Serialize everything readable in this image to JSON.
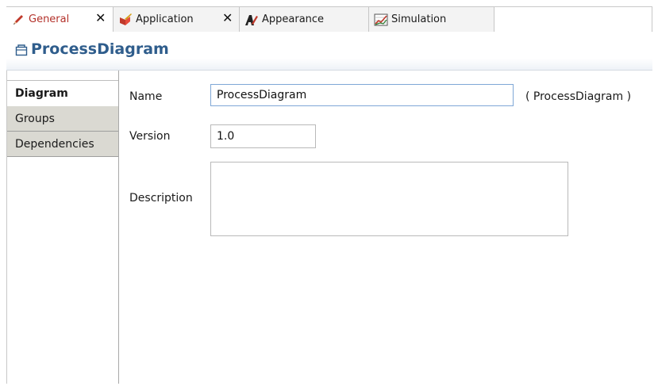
{
  "tabs": [
    {
      "label": "General",
      "icon": "pencil-icon",
      "closable": true,
      "active": true
    },
    {
      "label": "Application",
      "icon": "application-icon",
      "closable": true,
      "active": false
    },
    {
      "label": "Appearance",
      "icon": "appearance-icon",
      "closable": false,
      "active": false
    },
    {
      "label": "Simulation",
      "icon": "simulation-chart-icon",
      "closable": false,
      "active": false
    }
  ],
  "tab_close_glyph": "✕",
  "header": {
    "title": "ProcessDiagram",
    "icon": "diagram-icon",
    "title_color": "#2f5d8c"
  },
  "nav": {
    "items": [
      "Diagram",
      "Groups",
      "Dependencies"
    ],
    "active": "Diagram"
  },
  "form": {
    "name_label": "Name",
    "name_value": "ProcessDiagram",
    "name_hint": "( ProcessDiagram )",
    "version_label": "Version",
    "version_value": "1.0",
    "description_label": "Description",
    "description_value": ""
  },
  "colors": {
    "active_tab_text": "#b3312a",
    "nav_bg": "#dad9d2",
    "focus_border": "#7fa7d6"
  }
}
